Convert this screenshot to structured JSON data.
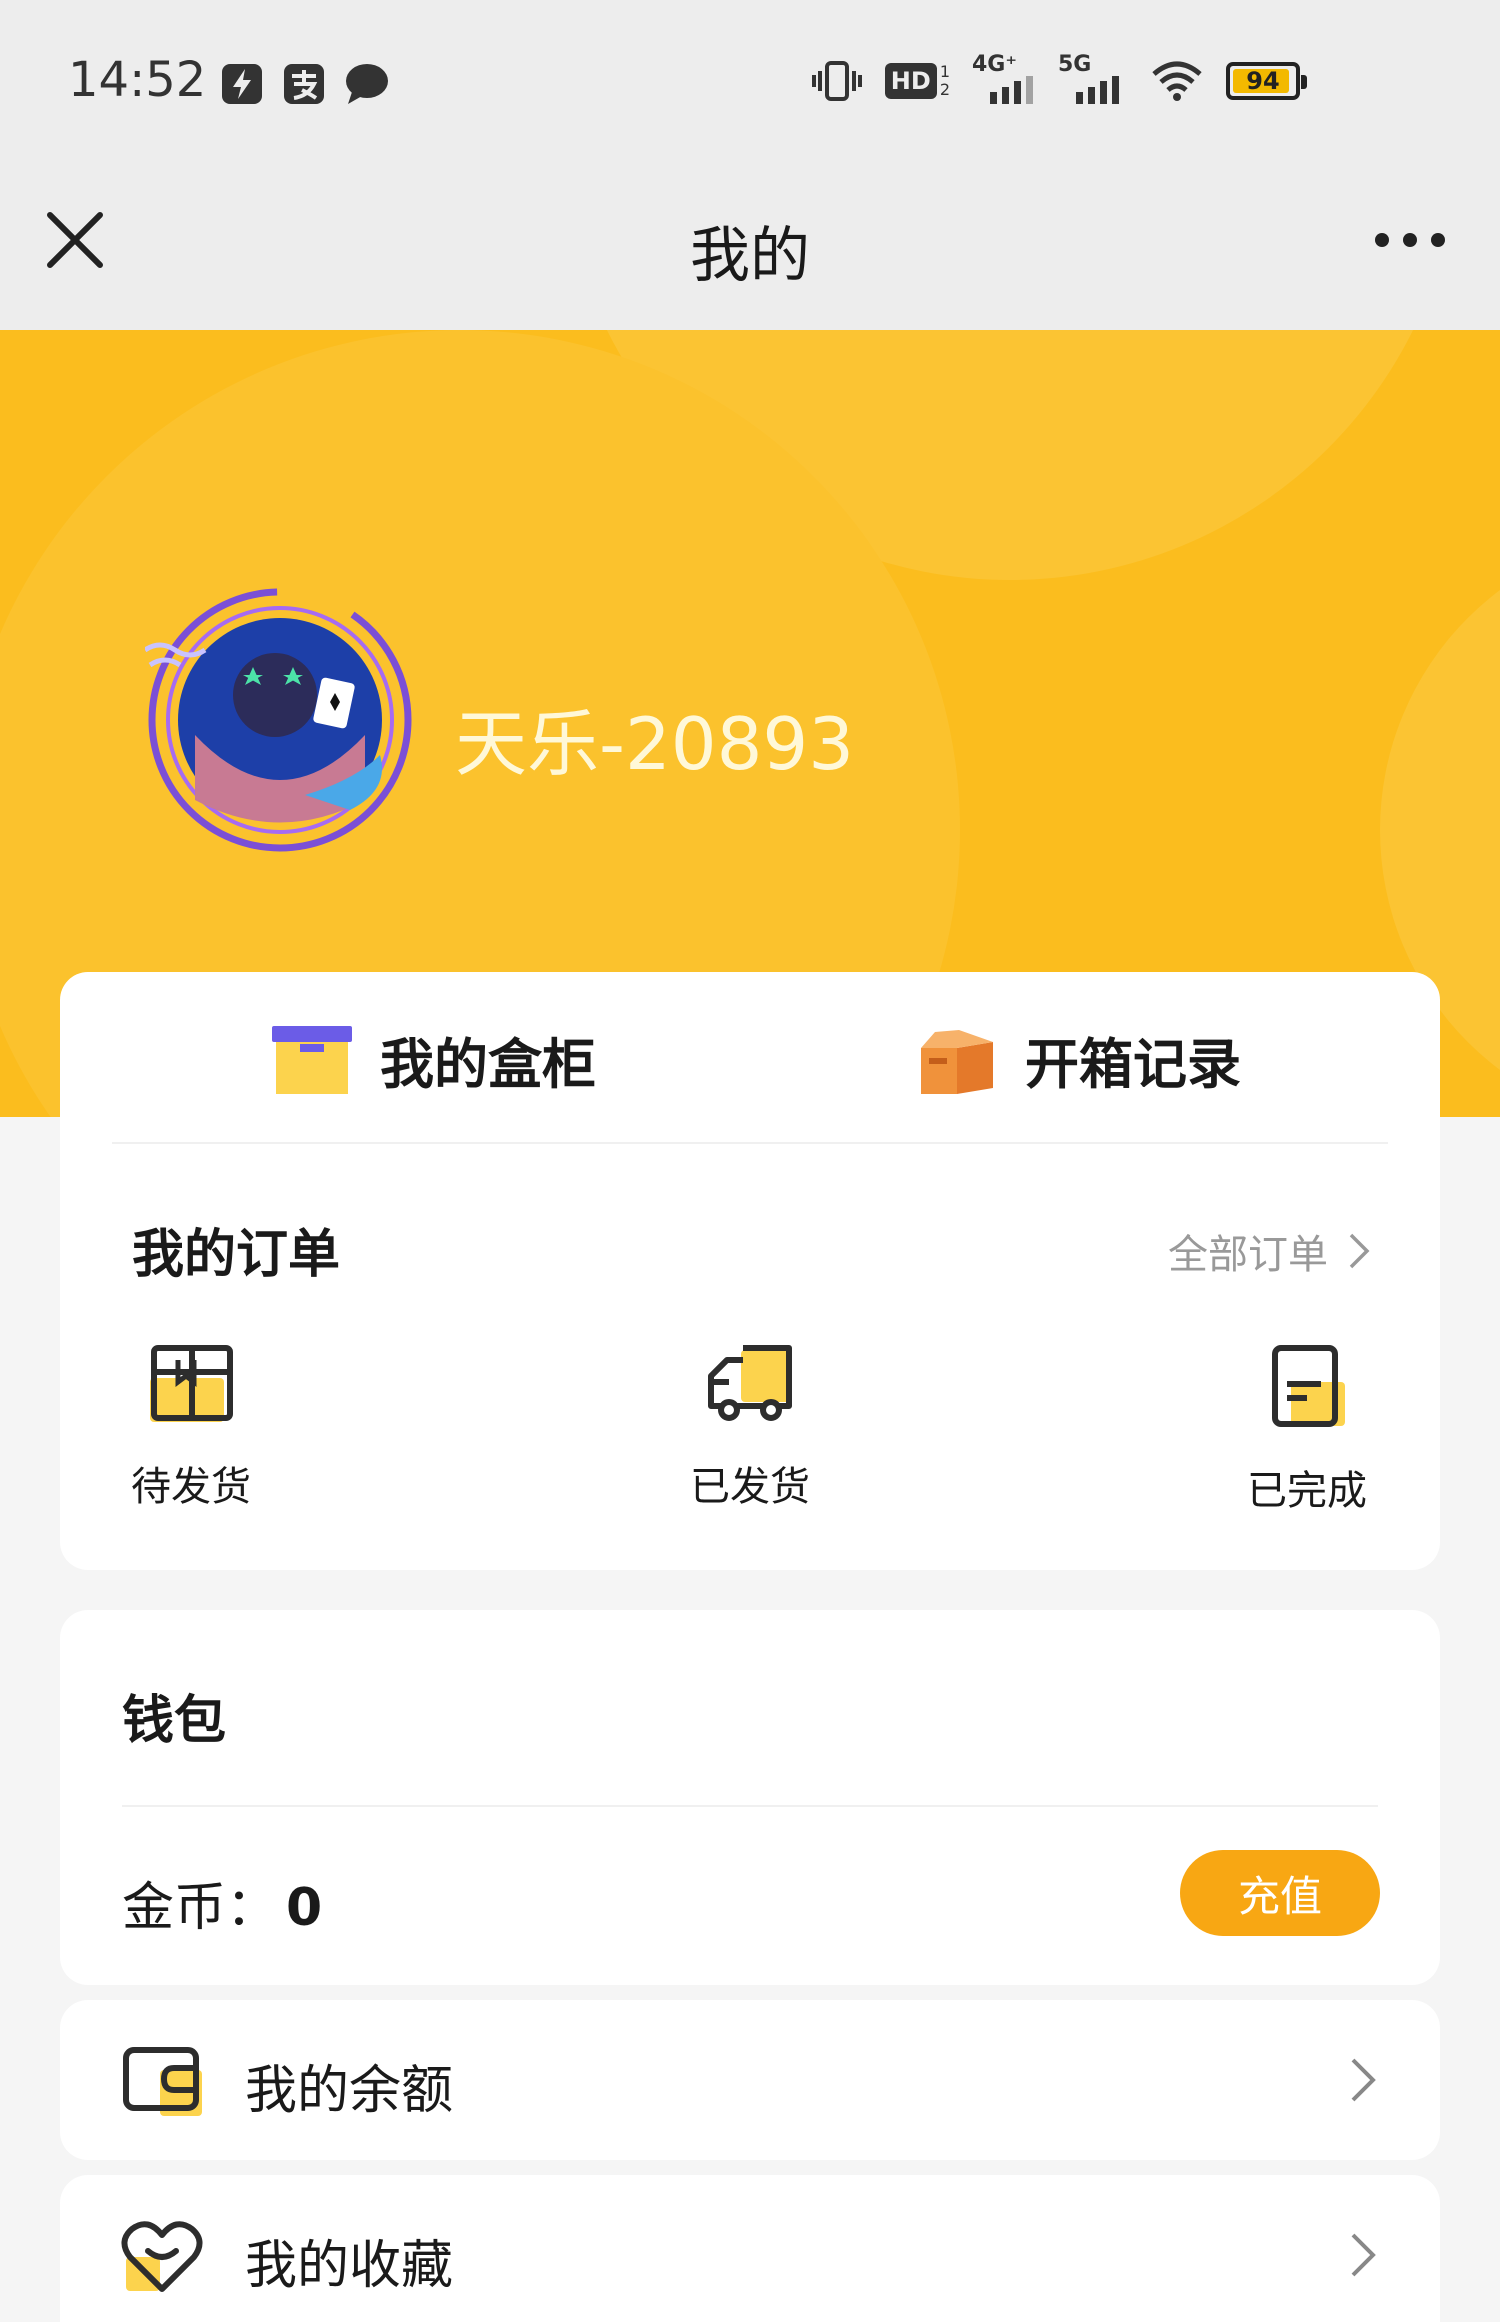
{
  "status_bar": {
    "time": "14:52",
    "battery": "94",
    "battery_level": 0.94,
    "network_hd": "HD",
    "network_4g": "4G⁺",
    "network_5g": "5G"
  },
  "nav": {
    "title": "我的"
  },
  "profile": {
    "username": "天乐-20893"
  },
  "quick_actions": {
    "cabinet_label": "我的盒柜",
    "records_label": "开箱记录"
  },
  "orders": {
    "title": "我的订单",
    "all_orders_label": "全部订单",
    "items": [
      {
        "label": "待发货"
      },
      {
        "label": "已发货"
      },
      {
        "label": "已完成"
      }
    ]
  },
  "wallet": {
    "title": "钱包",
    "coins_label": "金币：",
    "coins_value": "0",
    "recharge_label": "充值"
  },
  "menu": [
    {
      "label": "我的余额",
      "icon": "wallet-icon"
    },
    {
      "label": "我的收藏",
      "icon": "heart-icon"
    }
  ],
  "colors": {
    "banner": "#fbbd1e",
    "accent": "#f8a713",
    "page_background": "#f5f5f5"
  }
}
